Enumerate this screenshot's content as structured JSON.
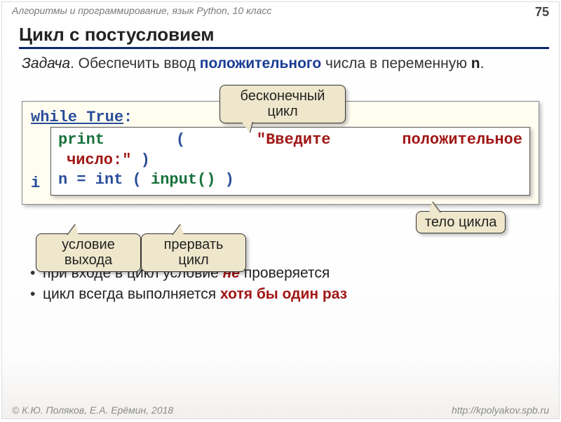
{
  "header": {
    "breadcrumb": "Алгоритмы и программирование, язык Python, 10 класс",
    "page_number": "75"
  },
  "title": "Цикл с постусловием",
  "task": {
    "label": "Задача",
    "prefix": ". Обеспечить ввод ",
    "highlight1": "положительного",
    "mid": " числа в переменную ",
    "variable": "n",
    "suffix": "."
  },
  "code": {
    "line1_a": "while True",
    "line1_b": ":",
    "line3_a": "i",
    "inner_print": "print",
    "inner_paren1": "(",
    "inner_string_a": "\"Введите",
    "inner_string_b": "положительное",
    "inner_string_c": "число:\"",
    "inner_paren2": ")",
    "inner_line2_a": "n = int (",
    "inner_line2_b": "input()",
    "inner_line2_c": ")"
  },
  "callouts": {
    "infinite": "бесконечный цикл",
    "body": "тело цикла",
    "exit_cond": "условие выхода",
    "break": "прервать цикл"
  },
  "bullets": [
    {
      "pre": "при входе в цикл условие ",
      "em": "не",
      "post": " проверяется"
    },
    {
      "pre": "цикл всегда выполняется ",
      "em": "хотя бы один раз",
      "post": ""
    }
  ],
  "footer": {
    "copyright": "© К.Ю. Поляков, Е.А. Ерёмин, 2018",
    "url": "http://kpolyakov.spb.ru"
  }
}
